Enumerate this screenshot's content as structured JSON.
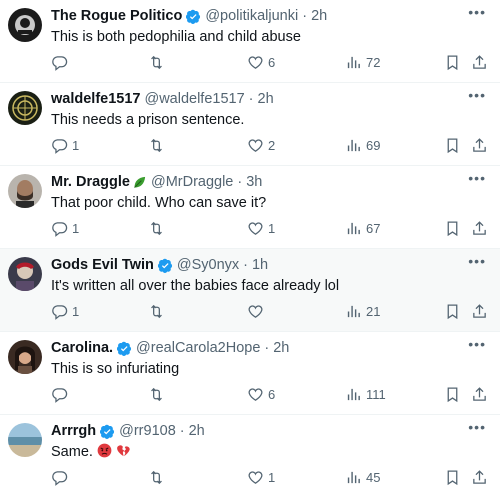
{
  "tweets": [
    {
      "name": "The Rogue Politico",
      "verified": true,
      "handle": "@politikaljunki",
      "time": "2h",
      "text": "This is both pedophilia and child abuse",
      "replies": "",
      "retweets": "",
      "likes": "6",
      "views": "72",
      "avatar_color": "#1b1b1b"
    },
    {
      "name": "waldelfe1517",
      "verified": false,
      "handle": "@waldelfe1517",
      "time": "2h",
      "text": "This needs a prison sentence.",
      "replies": "1",
      "retweets": "",
      "likes": "2",
      "views": "69",
      "avatar_color": "#1a1f14"
    },
    {
      "name": "Mr. Draggle",
      "verified": false,
      "handle": "@MrDraggle",
      "time": "3h",
      "text": "That poor child. Who can save it?",
      "replies": "1",
      "retweets": "",
      "likes": "1",
      "views": "67",
      "avatar_color": "#b9b4ad"
    },
    {
      "name": "Gods Evil Twin",
      "verified": true,
      "handle": "@Sy0nyx",
      "time": "1h",
      "text": "It's written all over the babies face already lol",
      "replies": "1",
      "retweets": "",
      "likes": "",
      "views": "21",
      "avatar_color": "#3a3a4a"
    },
    {
      "name": "Carolina.",
      "verified": true,
      "handle": "@realCarola2Hope",
      "time": "2h",
      "text": "This is so infuriating",
      "replies": "",
      "retweets": "",
      "likes": "6",
      "views": "111",
      "avatar_color": "#3a2a22"
    },
    {
      "name": "Arrrgh",
      "verified": true,
      "handle": "@rr9108",
      "time": "2h",
      "text": "Same.",
      "replies": "",
      "retweets": "",
      "likes": "1",
      "views": "45",
      "avatar_color": "#7fa7bf"
    }
  ],
  "colors": {
    "verified": "#1d9bf0",
    "icon": "#536471",
    "text": "#0f1419"
  }
}
